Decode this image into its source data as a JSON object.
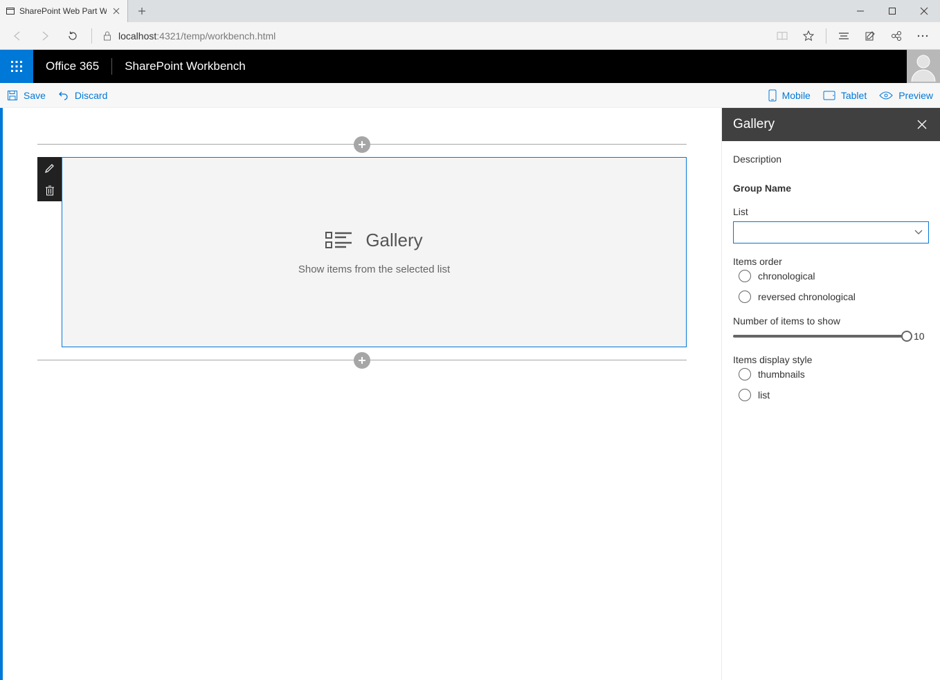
{
  "browser": {
    "tab_title": "SharePoint Web Part W",
    "url_host": "localhost",
    "url_port_path": ":4321/temp/workbench.html"
  },
  "suite": {
    "brand": "Office 365",
    "app_title": "SharePoint Workbench"
  },
  "commands": {
    "save": "Save",
    "discard": "Discard",
    "mobile": "Mobile",
    "tablet": "Tablet",
    "preview": "Preview"
  },
  "webpart": {
    "title": "Gallery",
    "description": "Show items from the selected list"
  },
  "pane": {
    "title": "Gallery",
    "description_label": "Description",
    "group_name": "Group Name",
    "list_label": "List",
    "list_value": "",
    "items_order": {
      "label": "Items order",
      "options": {
        "chronological": "chronological",
        "reversed": "reversed chronological"
      }
    },
    "num_items": {
      "label": "Number of items to show",
      "value": "10"
    },
    "display_style": {
      "label": "Items display style",
      "options": {
        "thumbnails": "thumbnails",
        "list": "list"
      }
    }
  }
}
